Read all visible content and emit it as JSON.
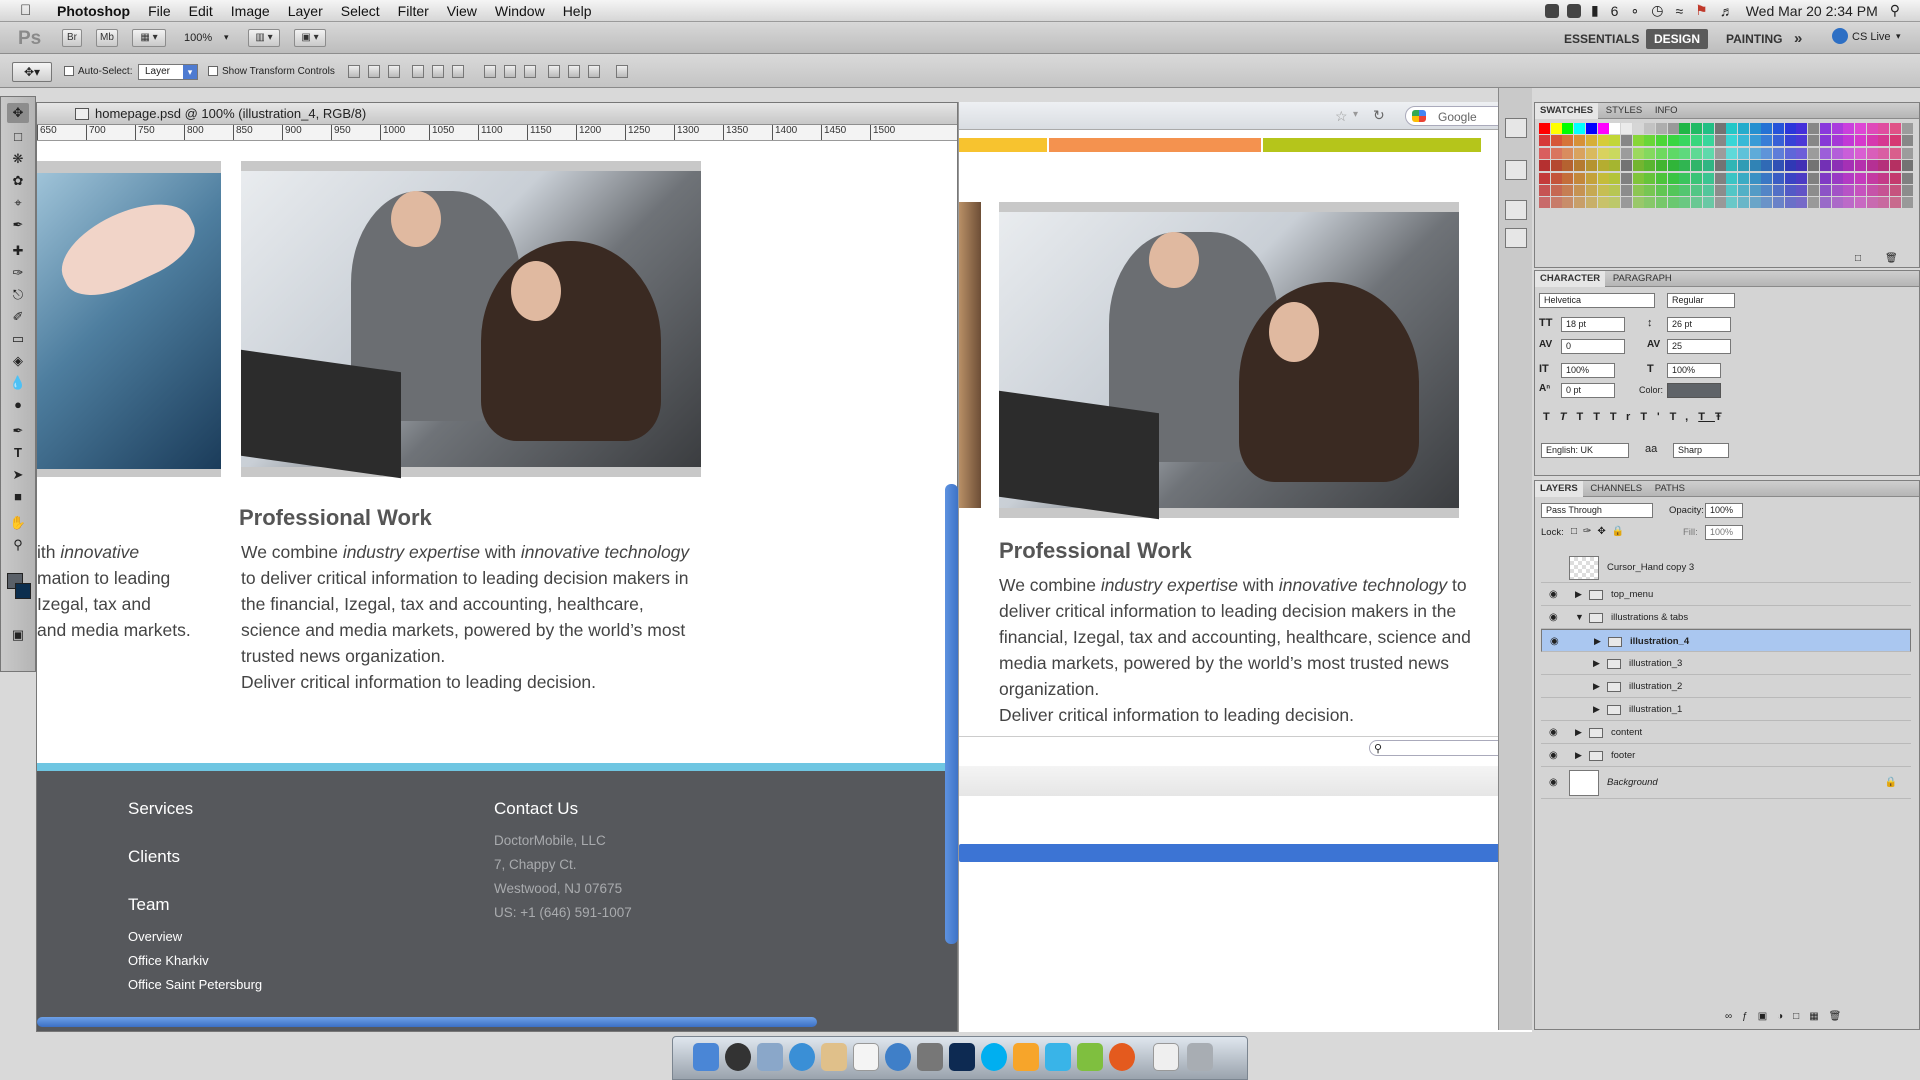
{
  "menubar": {
    "app_name": "Photoshop",
    "items": [
      "File",
      "Edit",
      "Image",
      "Layer",
      "Select",
      "Filter",
      "View",
      "Window",
      "Help"
    ],
    "status": {
      "battery": "6",
      "datetime": "Wed Mar 20  2:34 PM"
    }
  },
  "appbar": {
    "logo": "Ps",
    "buttons": [
      "Br",
      "Mb"
    ],
    "zoom": "100%",
    "workspaces": [
      "ESSENTIALS",
      "DESIGN",
      "PAINTING"
    ],
    "active_workspace": "DESIGN",
    "more": "»",
    "cs_live": "CS Live"
  },
  "options": {
    "auto_select_label": "Auto-Select:",
    "auto_select_value": "Layer",
    "show_transform_label": "Show Transform Controls"
  },
  "document": {
    "title": "homepage.psd @ 100% (illustration_4, RGB/8)",
    "ruler_ticks": [
      "650",
      "700",
      "750",
      "800",
      "850",
      "900",
      "950",
      "1000",
      "1050",
      "1100",
      "1150",
      "1200",
      "1250",
      "1300",
      "1350",
      "1400",
      "1450",
      "1500"
    ]
  },
  "page": {
    "heading": "Professional Work",
    "para": {
      "p1": "We combine ",
      "p2": "industry expertise",
      "p3": " with ",
      "p4": "innovative",
      "p5": "technology",
      "p6": " to deliver critical information to leading decision makers in the financial, Izegal, tax and accounting, healthcare, science and media markets, powered by the world’s most trusted news organization.",
      "p7": "Deliver critical information to leading decision."
    },
    "left_fragment": {
      "l1a": "ith ",
      "l1b": "innovative",
      "l2": "mation to leading",
      "l3": "Izegal, tax and",
      "l4": "and media markets."
    }
  },
  "footer": {
    "links": [
      "Services",
      "Clients",
      "Team"
    ],
    "team_sub": [
      "Overview",
      "Office Kharkiv",
      "Office Saint Petersburg"
    ],
    "contact_title": "Contact Us",
    "contact_lines": [
      "DoctorMobile, LLC",
      "7, Chappy Ct.",
      "Westwood, NJ 07675",
      "US:  +1 (646) 591-1007"
    ]
  },
  "browser": {
    "search_engine": "Google",
    "color_bars": [
      "#f7c32f",
      "#f4924f",
      "#b5c51b"
    ],
    "progress_color": "#3c74d4"
  },
  "swatches_panel": {
    "tabs": [
      "SWATCHES",
      "STYLES",
      "INFO"
    ]
  },
  "character_panel": {
    "tabs": [
      "CHARACTER",
      "PARAGRAPH"
    ],
    "font_family": "Helvetica",
    "font_style": "Regular",
    "font_size": "18 pt",
    "leading": "26 pt",
    "kerning": "0",
    "tracking": "25",
    "vertical_scale": "100%",
    "horizontal_scale": "100%",
    "baseline_shift": "0 pt",
    "color_label": "Color:",
    "language": "English: UK",
    "aa_label": "aa",
    "antialias": "Sharp",
    "style_buttons": [
      "T",
      "T",
      "TT",
      "Tr",
      "T'",
      "T,",
      "T",
      "Ŧ"
    ]
  },
  "layers_panel": {
    "tabs": [
      "LAYERS",
      "CHANNELS",
      "PATHS"
    ],
    "blend_mode": "Pass Through",
    "opacity_label": "Opacity:",
    "opacity": "100%",
    "lock_label": "Lock:",
    "fill_label": "Fill:",
    "fill": "100%",
    "layers": [
      {
        "name": "Cursor_Hand copy 3",
        "visible": false,
        "indent": 0,
        "type": "layer"
      },
      {
        "name": "top_menu",
        "visible": true,
        "indent": 0,
        "type": "group"
      },
      {
        "name": "illustrations & tabs",
        "visible": true,
        "indent": 0,
        "type": "group-open"
      },
      {
        "name": "illustration_4",
        "visible": true,
        "indent": 1,
        "type": "group",
        "selected": true
      },
      {
        "name": "illustration_3",
        "visible": false,
        "indent": 1,
        "type": "group"
      },
      {
        "name": "illustration_2",
        "visible": false,
        "indent": 1,
        "type": "group"
      },
      {
        "name": "illustration_1",
        "visible": false,
        "indent": 1,
        "type": "group"
      },
      {
        "name": "content",
        "visible": true,
        "indent": 0,
        "type": "group"
      },
      {
        "name": "footer",
        "visible": true,
        "indent": 0,
        "type": "group"
      },
      {
        "name": "Background",
        "visible": true,
        "indent": 0,
        "type": "background"
      }
    ]
  }
}
